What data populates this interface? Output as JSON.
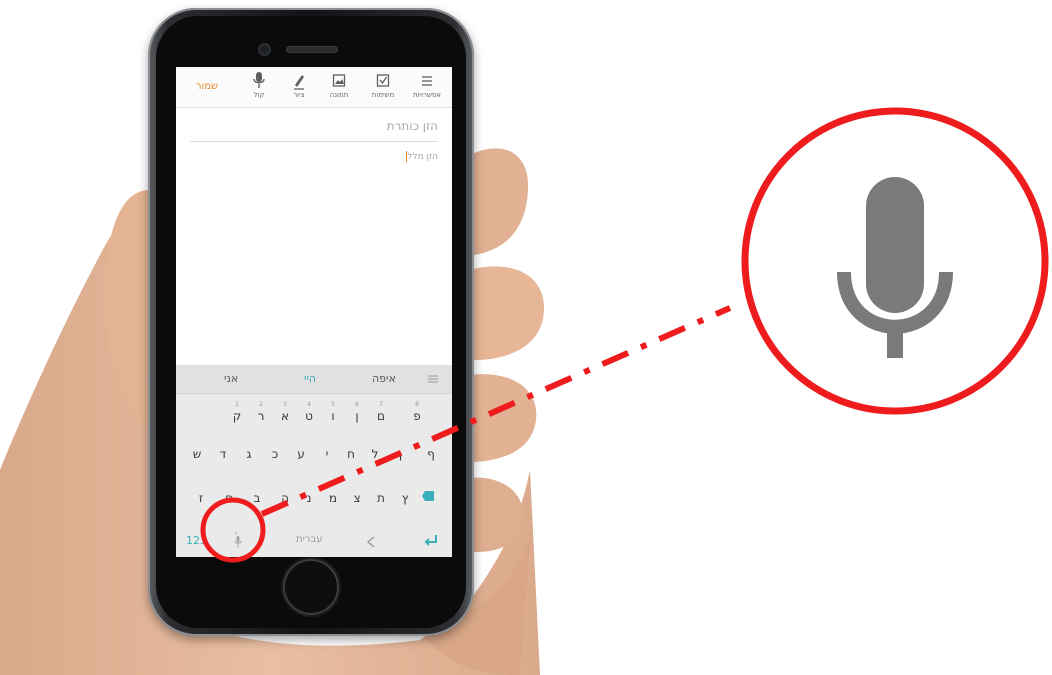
{
  "toolbar": {
    "save_label": "שמור",
    "tools": [
      {
        "label": "קול",
        "icon": "microphone-icon"
      },
      {
        "label": "ציור",
        "icon": "pen-icon"
      },
      {
        "label": "תמונה",
        "icon": "image-icon"
      },
      {
        "label": "משימות",
        "icon": "checkbox-icon"
      },
      {
        "label": "אפשרויות",
        "icon": "menu-icon"
      }
    ]
  },
  "note": {
    "title_placeholder": "הזן כותרת",
    "body_placeholder": "הזן מלל"
  },
  "keyboard": {
    "suggestions": [
      "אני",
      "היי",
      "איפה"
    ],
    "row1": [
      {
        "n": "1",
        "c": "ק"
      },
      {
        "n": "2",
        "c": "ר"
      },
      {
        "n": "3",
        "c": "א"
      },
      {
        "n": "4",
        "c": "ט"
      },
      {
        "n": "5",
        "c": "ו"
      },
      {
        "n": "6",
        "c": "ן"
      },
      {
        "n": "7",
        "c": "ם"
      },
      {
        "n": "8",
        "c": "פ"
      }
    ],
    "row2": [
      {
        "n": "",
        "c": "ש"
      },
      {
        "n": "",
        "c": "ד"
      },
      {
        "n": "",
        "c": "ג"
      },
      {
        "n": "",
        "c": "כ"
      },
      {
        "n": "",
        "c": "ע"
      },
      {
        "n": "",
        "c": "י"
      },
      {
        "n": "",
        "c": "ח"
      },
      {
        "n": "",
        "c": "ל"
      },
      {
        "n": "",
        "c": "ך"
      },
      {
        "n": "",
        "c": "ף"
      }
    ],
    "row3": [
      {
        "n": "",
        "c": "ז"
      },
      {
        "n": "",
        "c": "ס"
      },
      {
        "n": "",
        "c": "ב"
      },
      {
        "n": "",
        "c": "ה"
      },
      {
        "n": "",
        "c": "נ"
      },
      {
        "n": "",
        "c": "מ"
      },
      {
        "n": "",
        "c": "צ"
      },
      {
        "n": "",
        "c": "ת"
      },
      {
        "n": "",
        "c": "ץ"
      }
    ],
    "numbers_key": "123",
    "language_key": "עברית",
    "comma_key": "."
  },
  "colors": {
    "annotation": "#ee1c1c",
    "accent": "#e08a2c",
    "keyboard_highlight": "#3ab0b8"
  }
}
